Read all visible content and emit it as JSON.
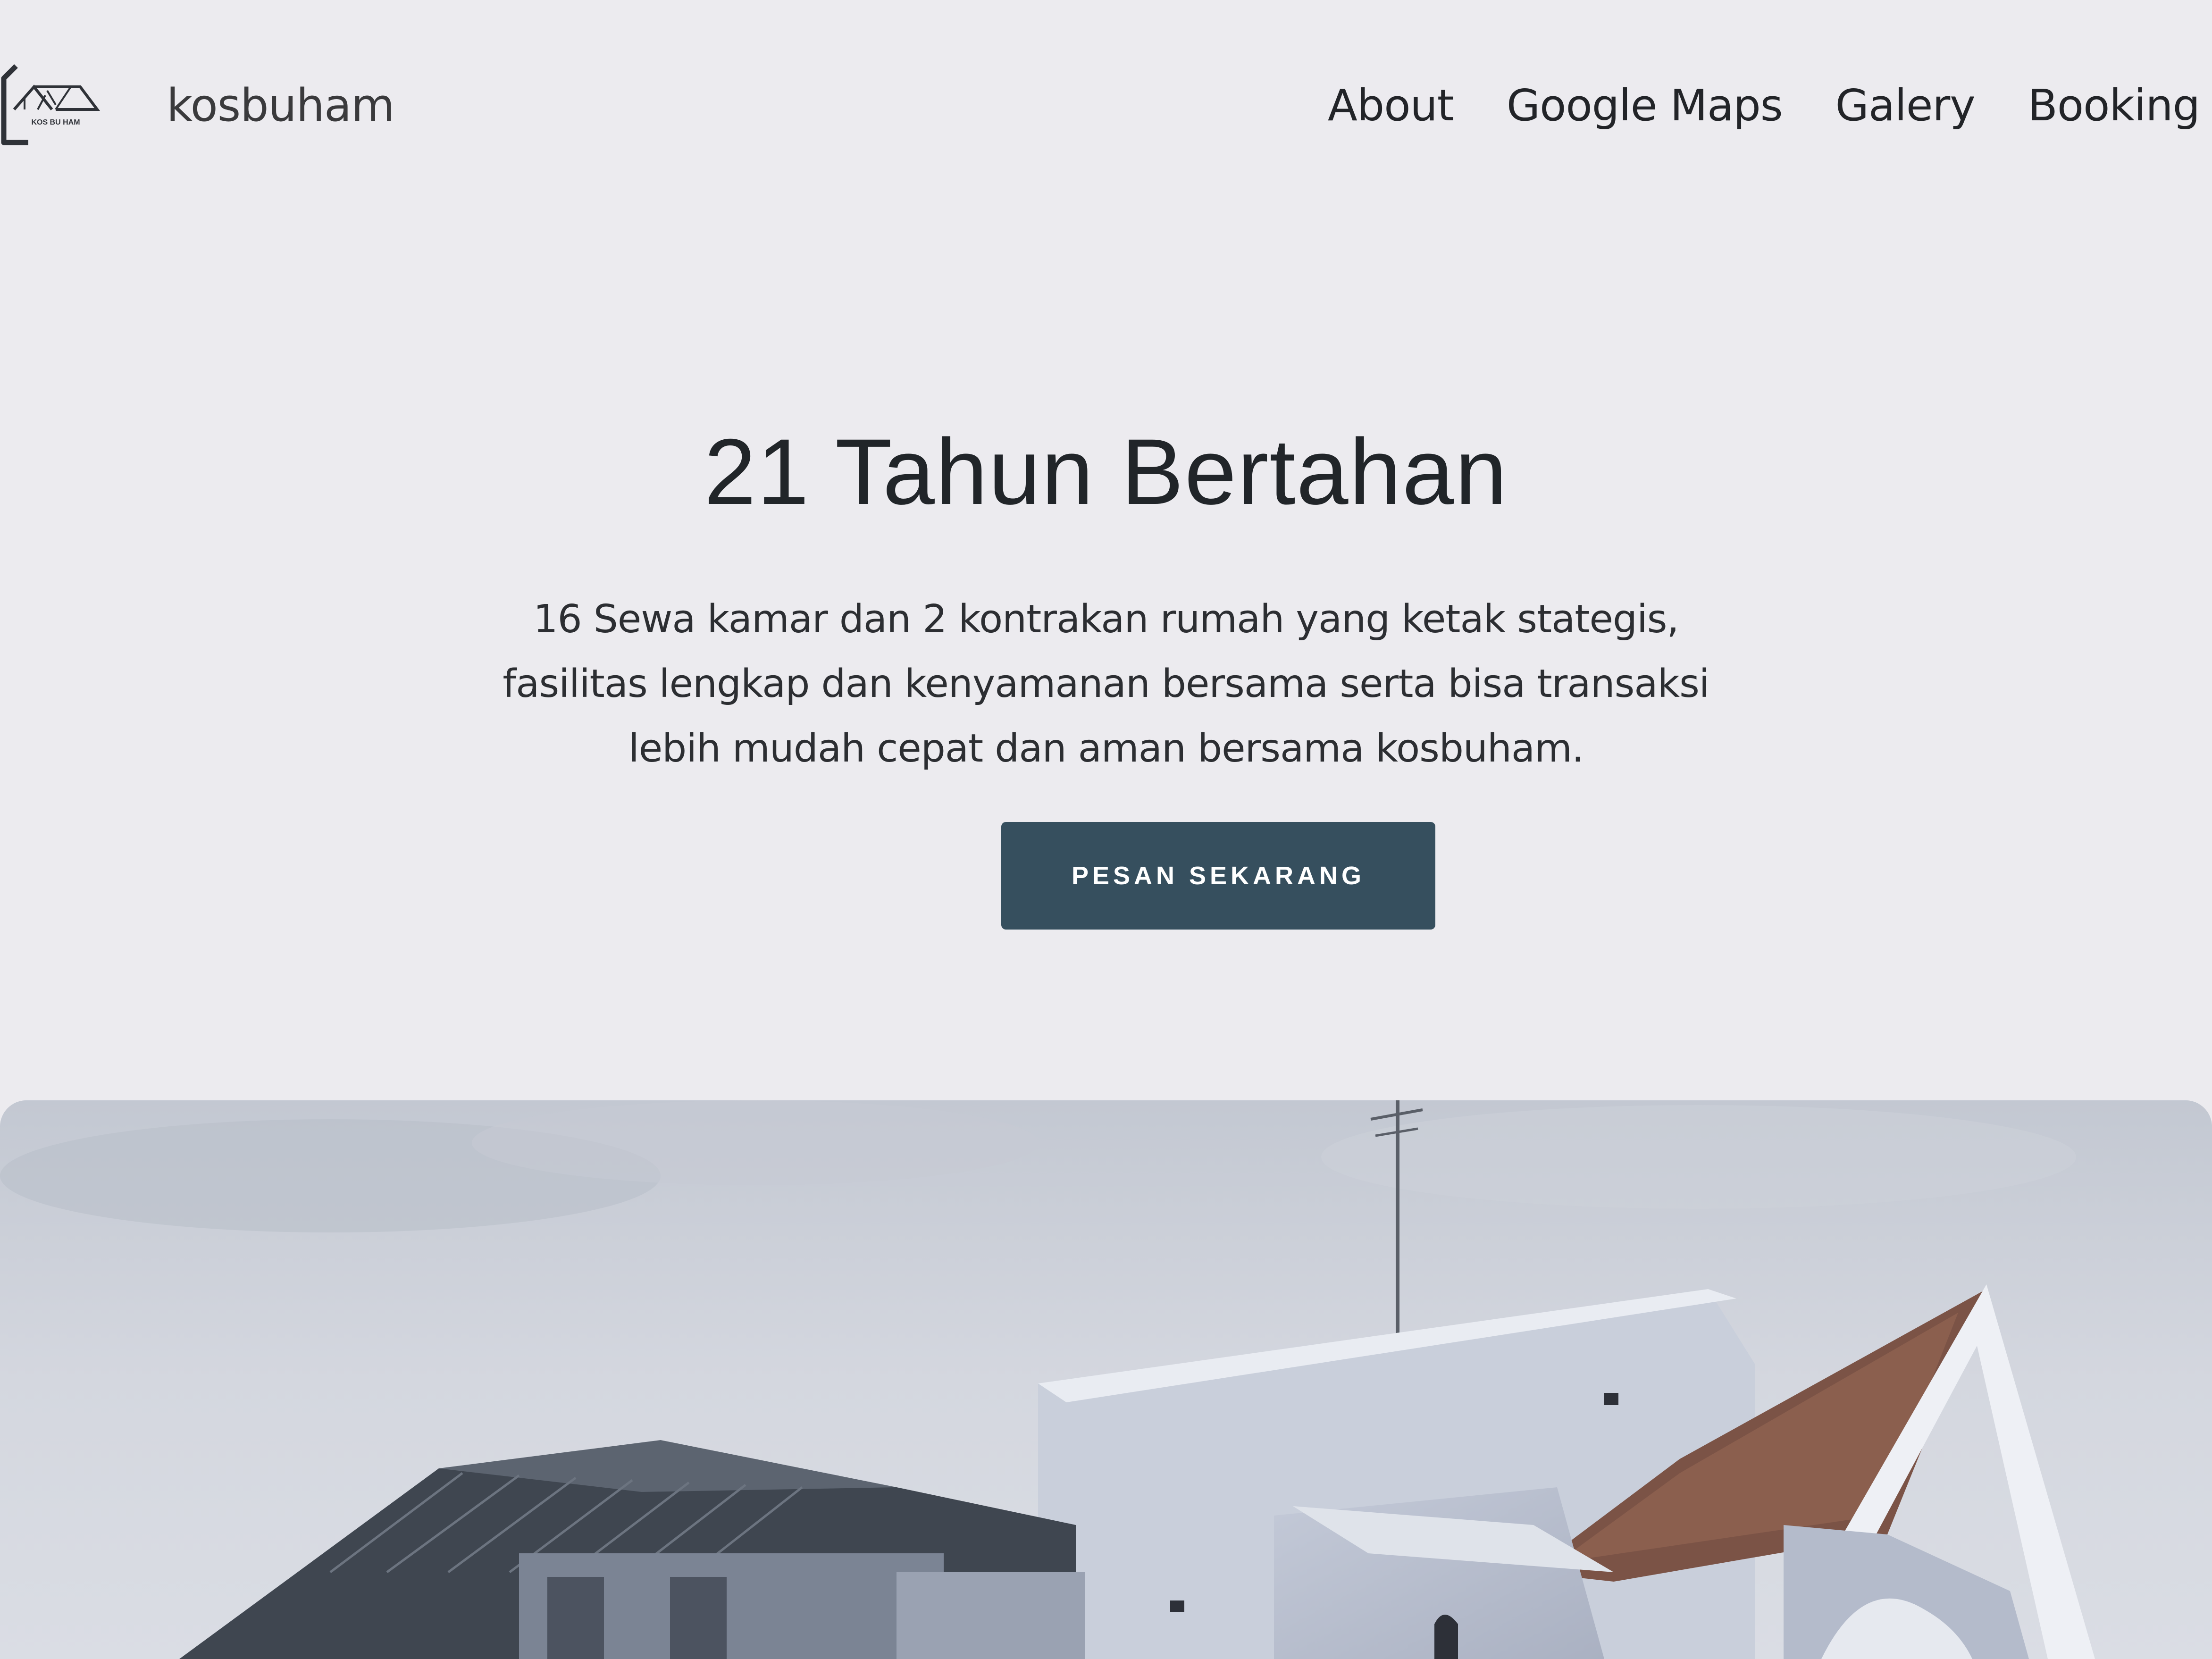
{
  "header": {
    "logo_text": "KOS BU HAM",
    "brand": "kosbuham",
    "nav": [
      {
        "label": "About"
      },
      {
        "label": "Google Maps"
      },
      {
        "label": "Galery"
      },
      {
        "label": "Booking"
      }
    ]
  },
  "hero": {
    "title": "21 Tahun Bertahan",
    "subtitle": "16 Sewa kamar dan 2 kontrakan rumah yang ketak stategis, fasilitas lengkap dan kenyamanan bersama serta bisa transaksi lebih mudah cepat dan aman bersama kosbuham.",
    "cta_label": "PESAN SEKARANG"
  },
  "colors": {
    "background": "#ecebef",
    "button": "#364f5e",
    "text": "#212529"
  }
}
